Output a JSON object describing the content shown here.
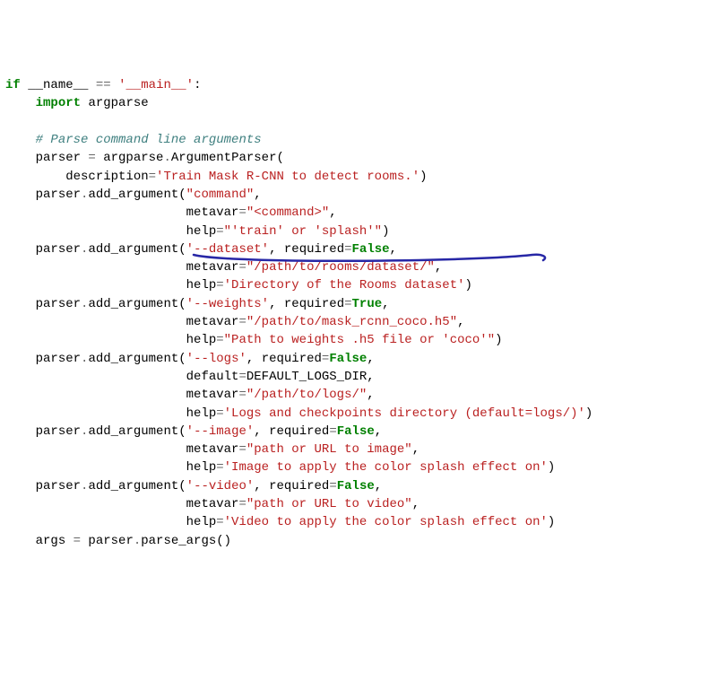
{
  "code": {
    "l1": {
      "if": "if",
      "dunder": "__name__",
      "eq": "==",
      "main": "'__main__'",
      "colon": ":"
    },
    "l2": {
      "import": "import",
      "mod": "argparse"
    },
    "l3": {
      "comment": "# Parse command line arguments"
    },
    "l4": {
      "lhs": "parser ",
      "eq": "=",
      "rhs": " argparse",
      "dot": ".",
      "fn": "ArgumentParser",
      "open": "("
    },
    "l5": {
      "kw": "description",
      "eq": "=",
      "val": "'Train Mask R-CNN to detect rooms.'",
      "close": ")"
    },
    "l6": {
      "obj": "parser",
      "dot": ".",
      "fn": "add_argument",
      "open": "(",
      "arg": "\"command\"",
      "comma": ","
    },
    "l7": {
      "kw": "metavar",
      "eq": "=",
      "val": "\"<command>\"",
      "comma": ","
    },
    "l8": {
      "kw": "help",
      "eq": "=",
      "val": "\"'train' or 'splash'\"",
      "close": ")"
    },
    "l9": {
      "obj": "parser",
      "dot": ".",
      "fn": "add_argument",
      "open": "(",
      "arg": "'--dataset'",
      "comma1": ",",
      "kw": " required",
      "eq": "=",
      "bool": "False",
      "comma2": ","
    },
    "l10": {
      "kw": "metavar",
      "eq": "=",
      "val": "\"/path/to/rooms/dataset/\"",
      "comma": ","
    },
    "l11": {
      "kw": "help",
      "eq": "=",
      "val": "'Directory of the Rooms dataset'",
      "close": ")"
    },
    "l12": {
      "obj": "parser",
      "dot": ".",
      "fn": "add_argument",
      "open": "(",
      "arg": "'--weights'",
      "comma1": ",",
      "kw": " required",
      "eq": "=",
      "bool": "True",
      "comma2": ","
    },
    "l13": {
      "kw": "metavar",
      "eq": "=",
      "val": "\"/path/to/mask_rcnn_coco.h5\"",
      "comma": ","
    },
    "l14": {
      "kw": "help",
      "eq": "=",
      "val": "\"Path to weights .h5 file or 'coco'\"",
      "close": ")"
    },
    "l15": {
      "obj": "parser",
      "dot": ".",
      "fn": "add_argument",
      "open": "(",
      "arg": "'--logs'",
      "comma1": ",",
      "kw": " required",
      "eq": "=",
      "bool": "False",
      "comma2": ","
    },
    "l16": {
      "kw": "default",
      "eq": "=",
      "val": "DEFAULT_LOGS_DIR",
      "comma": ","
    },
    "l17": {
      "kw": "metavar",
      "eq": "=",
      "val": "\"/path/to/logs/\"",
      "comma": ","
    },
    "l18": {
      "kw": "help",
      "eq": "=",
      "val": "'Logs and checkpoints directory (default=logs/)'",
      "close": ")"
    },
    "l19": {
      "obj": "parser",
      "dot": ".",
      "fn": "add_argument",
      "open": "(",
      "arg": "'--image'",
      "comma1": ",",
      "kw": " required",
      "eq": "=",
      "bool": "False",
      "comma2": ","
    },
    "l20": {
      "kw": "metavar",
      "eq": "=",
      "val": "\"path or URL to image\"",
      "comma": ","
    },
    "l21": {
      "kw": "help",
      "eq": "=",
      "val": "'Image to apply the color splash effect on'",
      "close": ")"
    },
    "l22": {
      "obj": "parser",
      "dot": ".",
      "fn": "add_argument",
      "open": "(",
      "arg": "'--video'",
      "comma1": ",",
      "kw": " required",
      "eq": "=",
      "bool": "False",
      "comma2": ","
    },
    "l23": {
      "kw": "metavar",
      "eq": "=",
      "val": "\"path or URL to video\"",
      "comma": ","
    },
    "l24": {
      "kw": "help",
      "eq": "=",
      "val": "'Video to apply the color splash effect on'",
      "close": ")"
    },
    "l25": {
      "lhs": "args ",
      "eq": "=",
      "obj": " parser",
      "dot": ".",
      "fn": "parse_args",
      "parens": "()"
    }
  },
  "annotation": {
    "color": "#2727a6"
  }
}
